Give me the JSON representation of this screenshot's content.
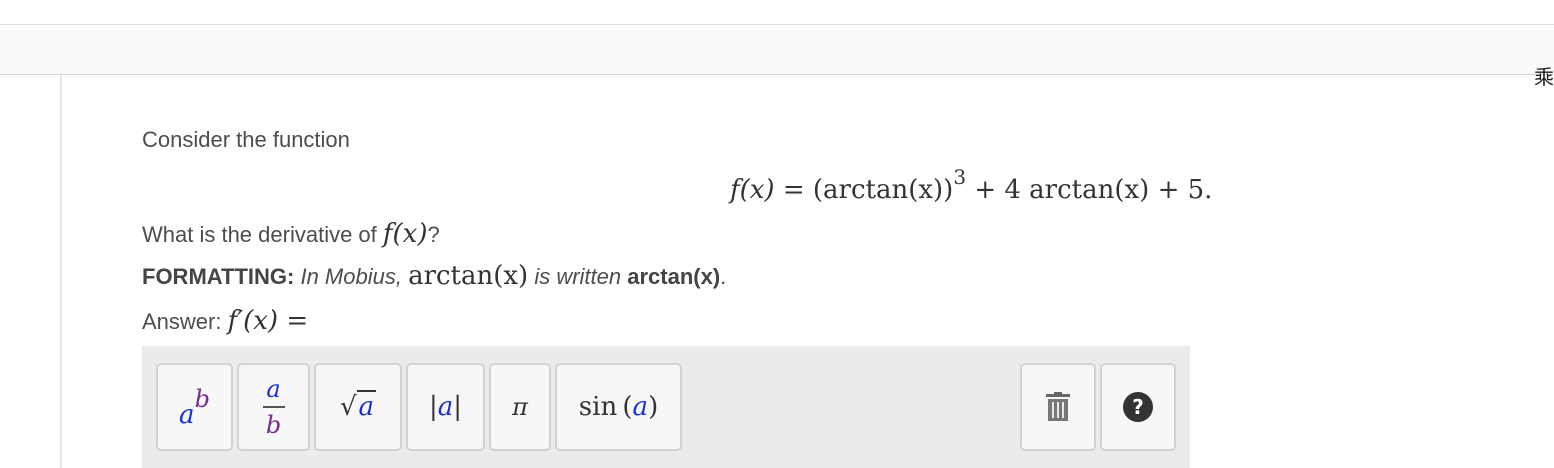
{
  "header": {
    "corner_glyph": "乘"
  },
  "problem": {
    "intro": "Consider the function",
    "display_math": {
      "lhs": "f(x) = ",
      "term1": "(arctan(x))",
      "exp": "3",
      "rest": " + 4 arctan(x) + 5."
    },
    "question_prefix": "What is the derivative of ",
    "question_math": "f(x)",
    "question_suffix": "?",
    "formatting_label": "FORMATTING:",
    "formatting_text1": " In Mobius, ",
    "formatting_math": "arctan(x)",
    "formatting_text2": " is written ",
    "formatting_code": "arctan(x)",
    "formatting_end": ".",
    "answer_label": "Answer: ",
    "answer_math": "f′(x) ="
  },
  "toolbar": {
    "buttons": {
      "power": {
        "base": "a",
        "exp": "b"
      },
      "fraction": {
        "num": "a",
        "den": "b"
      },
      "sqrt": {
        "radicand": "a",
        "symbol": "√"
      },
      "abs": {
        "inner": "a",
        "bar": "|"
      },
      "pi": {
        "symbol": "π"
      },
      "sin": {
        "fn": "sin",
        "arg": "a",
        "open": "(",
        "close": ")"
      },
      "help": {
        "symbol": "?"
      }
    },
    "icons": {
      "trash": "trash-icon",
      "help": "question-circle-icon"
    }
  },
  "colors": {
    "variable_blue": "#1a2fd1",
    "variable_purple": "#7a2b8f",
    "toolbar_bg": "#ebebeb"
  }
}
